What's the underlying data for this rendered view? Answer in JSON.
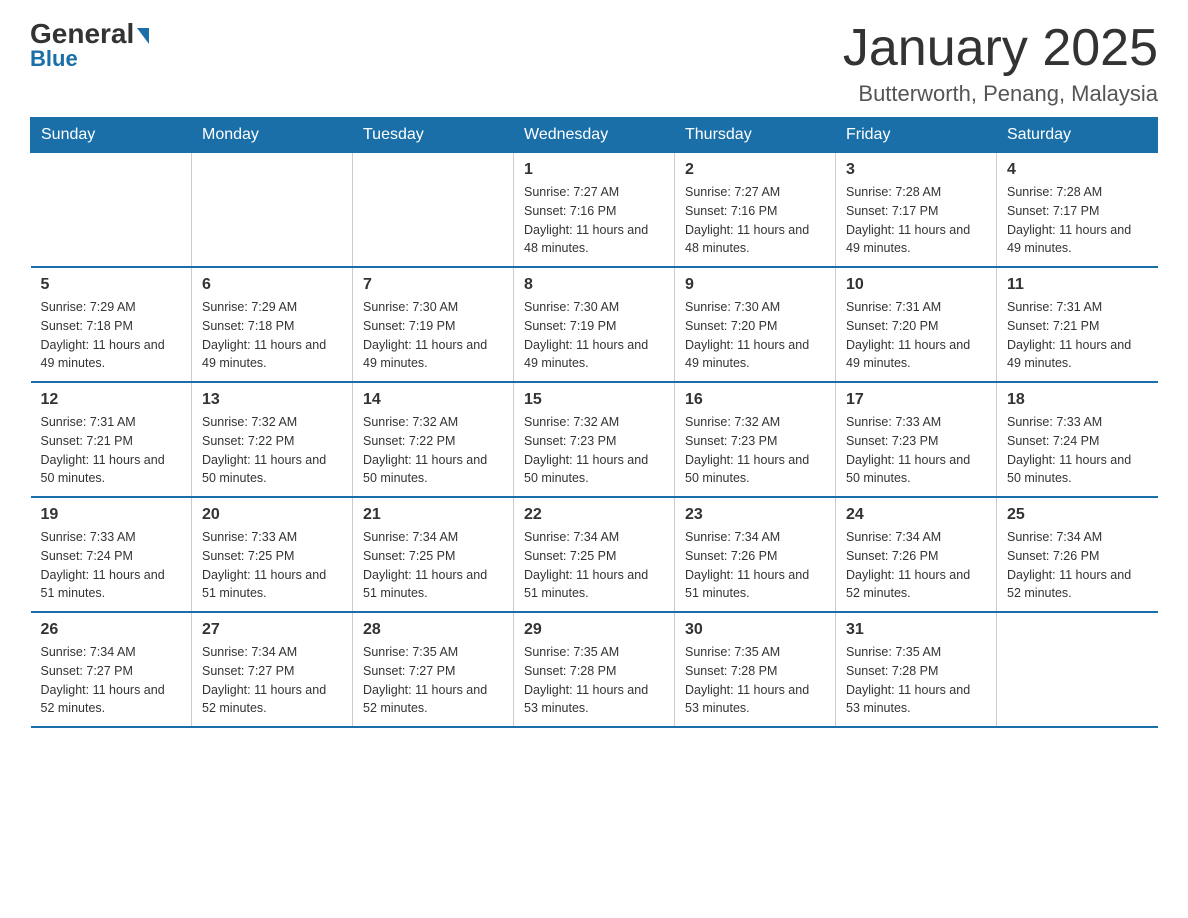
{
  "header": {
    "logo_general": "General",
    "logo_blue": "Blue",
    "title": "January 2025",
    "subtitle": "Butterworth, Penang, Malaysia"
  },
  "days_of_week": [
    "Sunday",
    "Monday",
    "Tuesday",
    "Wednesday",
    "Thursday",
    "Friday",
    "Saturday"
  ],
  "weeks": [
    [
      {
        "day": "",
        "info": ""
      },
      {
        "day": "",
        "info": ""
      },
      {
        "day": "",
        "info": ""
      },
      {
        "day": "1",
        "info": "Sunrise: 7:27 AM\nSunset: 7:16 PM\nDaylight: 11 hours and 48 minutes."
      },
      {
        "day": "2",
        "info": "Sunrise: 7:27 AM\nSunset: 7:16 PM\nDaylight: 11 hours and 48 minutes."
      },
      {
        "day": "3",
        "info": "Sunrise: 7:28 AM\nSunset: 7:17 PM\nDaylight: 11 hours and 49 minutes."
      },
      {
        "day": "4",
        "info": "Sunrise: 7:28 AM\nSunset: 7:17 PM\nDaylight: 11 hours and 49 minutes."
      }
    ],
    [
      {
        "day": "5",
        "info": "Sunrise: 7:29 AM\nSunset: 7:18 PM\nDaylight: 11 hours and 49 minutes."
      },
      {
        "day": "6",
        "info": "Sunrise: 7:29 AM\nSunset: 7:18 PM\nDaylight: 11 hours and 49 minutes."
      },
      {
        "day": "7",
        "info": "Sunrise: 7:30 AM\nSunset: 7:19 PM\nDaylight: 11 hours and 49 minutes."
      },
      {
        "day": "8",
        "info": "Sunrise: 7:30 AM\nSunset: 7:19 PM\nDaylight: 11 hours and 49 minutes."
      },
      {
        "day": "9",
        "info": "Sunrise: 7:30 AM\nSunset: 7:20 PM\nDaylight: 11 hours and 49 minutes."
      },
      {
        "day": "10",
        "info": "Sunrise: 7:31 AM\nSunset: 7:20 PM\nDaylight: 11 hours and 49 minutes."
      },
      {
        "day": "11",
        "info": "Sunrise: 7:31 AM\nSunset: 7:21 PM\nDaylight: 11 hours and 49 minutes."
      }
    ],
    [
      {
        "day": "12",
        "info": "Sunrise: 7:31 AM\nSunset: 7:21 PM\nDaylight: 11 hours and 50 minutes."
      },
      {
        "day": "13",
        "info": "Sunrise: 7:32 AM\nSunset: 7:22 PM\nDaylight: 11 hours and 50 minutes."
      },
      {
        "day": "14",
        "info": "Sunrise: 7:32 AM\nSunset: 7:22 PM\nDaylight: 11 hours and 50 minutes."
      },
      {
        "day": "15",
        "info": "Sunrise: 7:32 AM\nSunset: 7:23 PM\nDaylight: 11 hours and 50 minutes."
      },
      {
        "day": "16",
        "info": "Sunrise: 7:32 AM\nSunset: 7:23 PM\nDaylight: 11 hours and 50 minutes."
      },
      {
        "day": "17",
        "info": "Sunrise: 7:33 AM\nSunset: 7:23 PM\nDaylight: 11 hours and 50 minutes."
      },
      {
        "day": "18",
        "info": "Sunrise: 7:33 AM\nSunset: 7:24 PM\nDaylight: 11 hours and 50 minutes."
      }
    ],
    [
      {
        "day": "19",
        "info": "Sunrise: 7:33 AM\nSunset: 7:24 PM\nDaylight: 11 hours and 51 minutes."
      },
      {
        "day": "20",
        "info": "Sunrise: 7:33 AM\nSunset: 7:25 PM\nDaylight: 11 hours and 51 minutes."
      },
      {
        "day": "21",
        "info": "Sunrise: 7:34 AM\nSunset: 7:25 PM\nDaylight: 11 hours and 51 minutes."
      },
      {
        "day": "22",
        "info": "Sunrise: 7:34 AM\nSunset: 7:25 PM\nDaylight: 11 hours and 51 minutes."
      },
      {
        "day": "23",
        "info": "Sunrise: 7:34 AM\nSunset: 7:26 PM\nDaylight: 11 hours and 51 minutes."
      },
      {
        "day": "24",
        "info": "Sunrise: 7:34 AM\nSunset: 7:26 PM\nDaylight: 11 hours and 52 minutes."
      },
      {
        "day": "25",
        "info": "Sunrise: 7:34 AM\nSunset: 7:26 PM\nDaylight: 11 hours and 52 minutes."
      }
    ],
    [
      {
        "day": "26",
        "info": "Sunrise: 7:34 AM\nSunset: 7:27 PM\nDaylight: 11 hours and 52 minutes."
      },
      {
        "day": "27",
        "info": "Sunrise: 7:34 AM\nSunset: 7:27 PM\nDaylight: 11 hours and 52 minutes."
      },
      {
        "day": "28",
        "info": "Sunrise: 7:35 AM\nSunset: 7:27 PM\nDaylight: 11 hours and 52 minutes."
      },
      {
        "day": "29",
        "info": "Sunrise: 7:35 AM\nSunset: 7:28 PM\nDaylight: 11 hours and 53 minutes."
      },
      {
        "day": "30",
        "info": "Sunrise: 7:35 AM\nSunset: 7:28 PM\nDaylight: 11 hours and 53 minutes."
      },
      {
        "day": "31",
        "info": "Sunrise: 7:35 AM\nSunset: 7:28 PM\nDaylight: 11 hours and 53 minutes."
      },
      {
        "day": "",
        "info": ""
      }
    ]
  ]
}
